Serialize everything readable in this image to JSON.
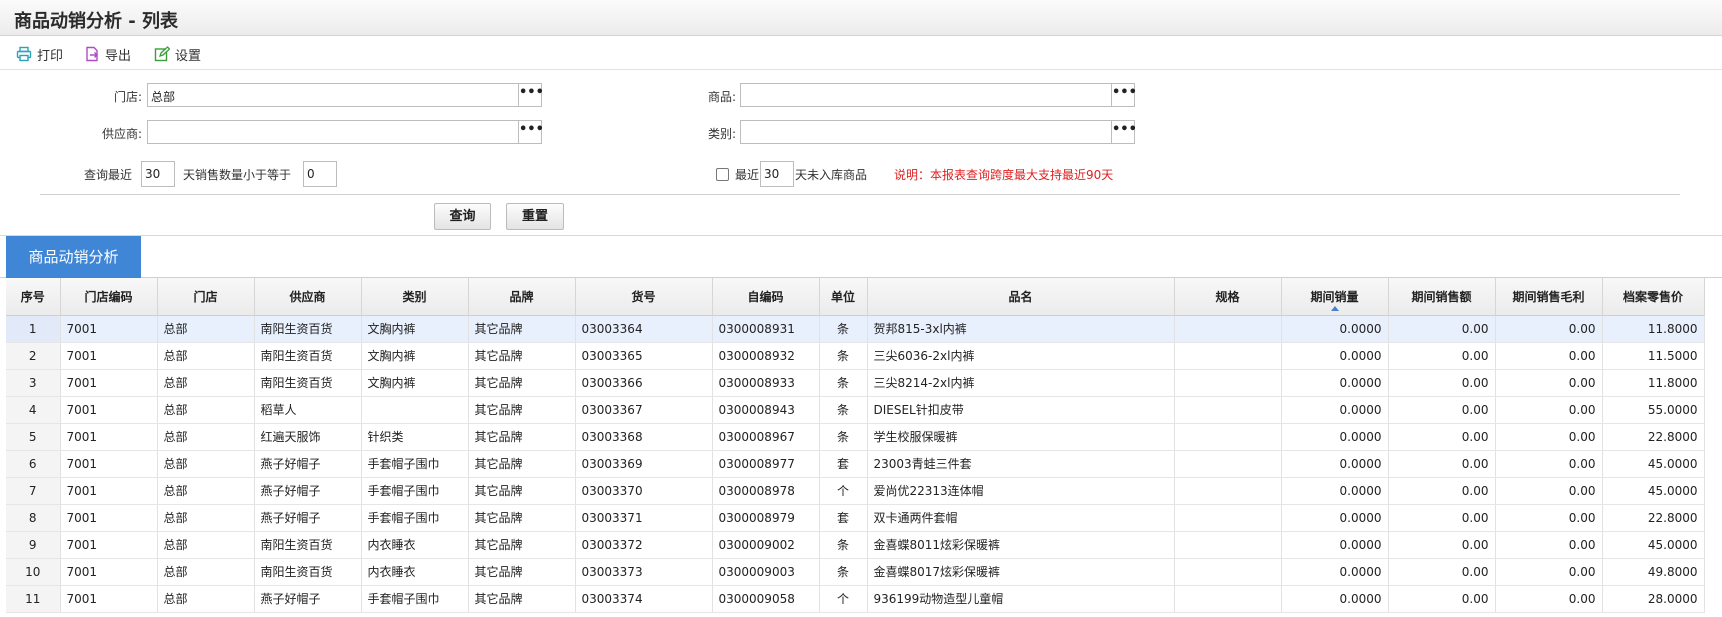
{
  "title": "商品动销分析 - 列表",
  "toolbar": {
    "print": "打印",
    "export": "导出",
    "settings": "设置"
  },
  "form": {
    "store_label": "门店:",
    "store_value": "总部",
    "product_label": "商品:",
    "product_value": "",
    "supplier_label": "供应商:",
    "supplier_value": "",
    "category_label": "类别:",
    "category_value": "",
    "recent_label": "查询最近",
    "recent_days": "30",
    "qty_label": "天销售数量小于等于",
    "qty_value": "0",
    "stock_prefix": "最近",
    "stock_days": "30",
    "stock_suffix": "天未入库商品",
    "note": "说明：本报表查询跨度最大支持最近90天",
    "query_button": "查询",
    "reset_button": "重置",
    "dots": "•••"
  },
  "tab": "商品动销分析",
  "columns": [
    "序号",
    "门店编码",
    "门店",
    "供应商",
    "类别",
    "品牌",
    "货号",
    "自编码",
    "单位",
    "品名",
    "规格",
    "期间销量",
    "期间销售额",
    "期间销售毛利",
    "档案零售价"
  ],
  "rows": [
    [
      "1",
      "7001",
      "总部",
      "南阳生资百货",
      "文胸内裤",
      "其它品牌",
      "03003364",
      "0300008931",
      "条",
      "贺邦815-3xl内裤",
      "",
      "0.0000",
      "0.00",
      "0.00",
      "11.8000"
    ],
    [
      "2",
      "7001",
      "总部",
      "南阳生资百货",
      "文胸内裤",
      "其它品牌",
      "03003365",
      "0300008932",
      "条",
      "三尖6036-2xl内裤",
      "",
      "0.0000",
      "0.00",
      "0.00",
      "11.5000"
    ],
    [
      "3",
      "7001",
      "总部",
      "南阳生资百货",
      "文胸内裤",
      "其它品牌",
      "03003366",
      "0300008933",
      "条",
      "三尖8214-2xl内裤",
      "",
      "0.0000",
      "0.00",
      "0.00",
      "11.8000"
    ],
    [
      "4",
      "7001",
      "总部",
      "稻草人",
      "",
      "其它品牌",
      "03003367",
      "0300008943",
      "条",
      "DIESEL针扣皮带",
      "",
      "0.0000",
      "0.00",
      "0.00",
      "55.0000"
    ],
    [
      "5",
      "7001",
      "总部",
      "红遍天服饰",
      "针织类",
      "其它品牌",
      "03003368",
      "0300008967",
      "条",
      "学生校服保暖裤",
      "",
      "0.0000",
      "0.00",
      "0.00",
      "22.8000"
    ],
    [
      "6",
      "7001",
      "总部",
      "燕子好帽子",
      "手套帽子围巾",
      "其它品牌",
      "03003369",
      "0300008977",
      "套",
      "23003青蛙三件套",
      "",
      "0.0000",
      "0.00",
      "0.00",
      "45.0000"
    ],
    [
      "7",
      "7001",
      "总部",
      "燕子好帽子",
      "手套帽子围巾",
      "其它品牌",
      "03003370",
      "0300008978",
      "个",
      "爱尚优22313连体帽",
      "",
      "0.0000",
      "0.00",
      "0.00",
      "45.0000"
    ],
    [
      "8",
      "7001",
      "总部",
      "燕子好帽子",
      "手套帽子围巾",
      "其它品牌",
      "03003371",
      "0300008979",
      "套",
      "双卡通两件套帽",
      "",
      "0.0000",
      "0.00",
      "0.00",
      "22.8000"
    ],
    [
      "9",
      "7001",
      "总部",
      "南阳生资百货",
      "内衣睡衣",
      "其它品牌",
      "03003372",
      "0300009002",
      "条",
      "金喜蝶8011炫彩保暖裤",
      "",
      "0.0000",
      "0.00",
      "0.00",
      "45.0000"
    ],
    [
      "10",
      "7001",
      "总部",
      "南阳生资百货",
      "内衣睡衣",
      "其它品牌",
      "03003373",
      "0300009003",
      "条",
      "金喜蝶8017炫彩保暖裤",
      "",
      "0.0000",
      "0.00",
      "0.00",
      "49.8000"
    ],
    [
      "11",
      "7001",
      "总部",
      "燕子好帽子",
      "手套帽子围巾",
      "其它品牌",
      "03003374",
      "0300009058",
      "个",
      "936199动物造型儿童帽",
      "",
      "0.0000",
      "0.00",
      "0.00",
      "28.0000"
    ]
  ],
  "colors": {
    "accent": "#3f86d6",
    "note": "#e02020",
    "selected_row": "#e8f0fd"
  }
}
